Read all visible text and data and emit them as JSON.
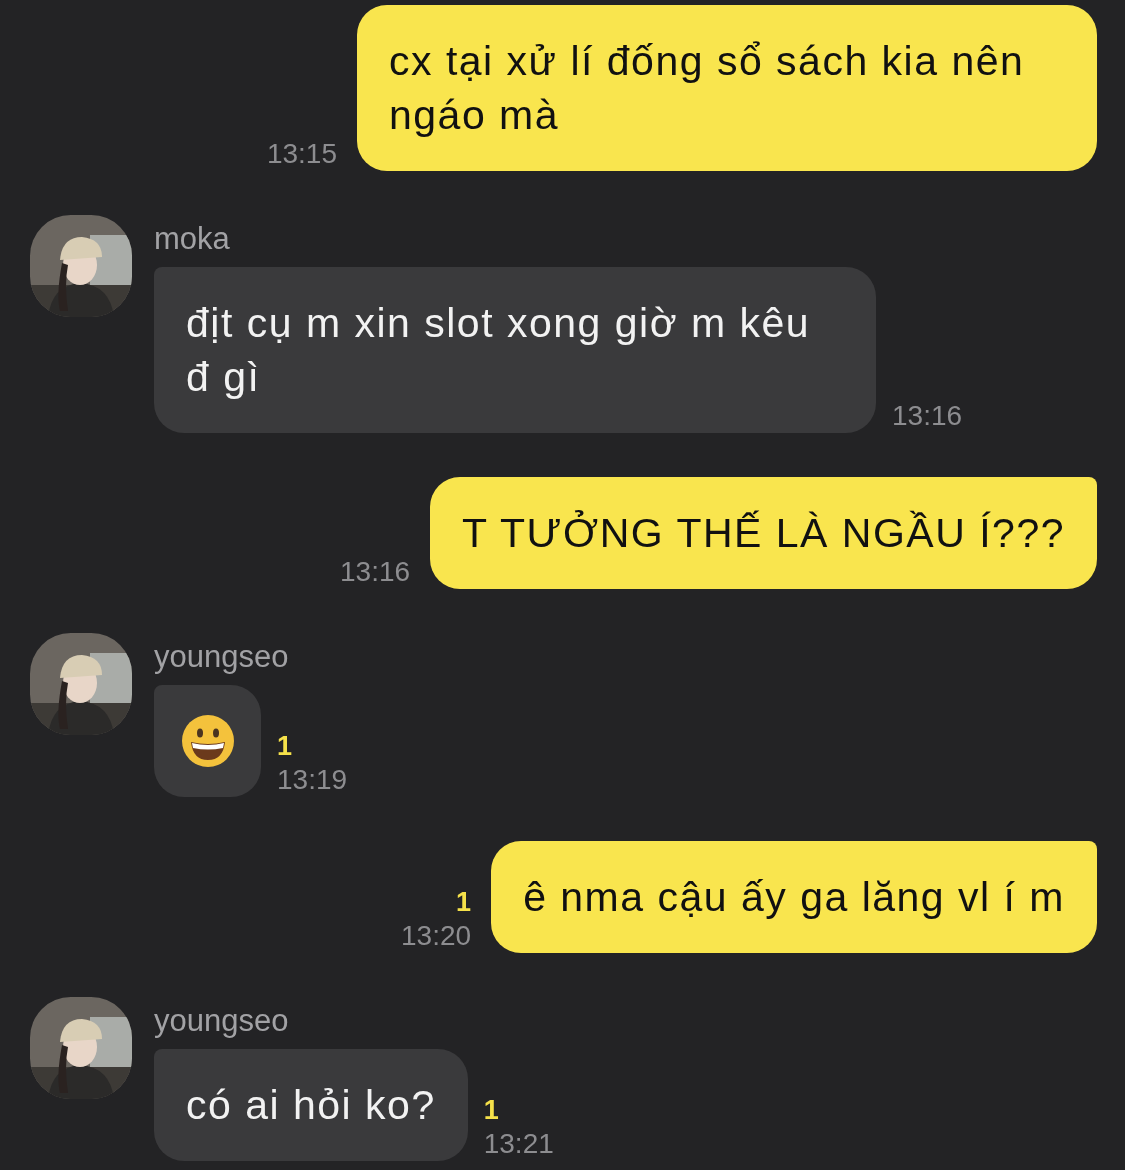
{
  "messages": [
    {
      "kind": "sent",
      "text": "cx tại xử lí đống sổ sách kia nên ngáo mà",
      "time": "13:15",
      "tail": false
    },
    {
      "kind": "received",
      "sender": "moka",
      "text": "địt cụ m xin slot xong giờ m kêu đ gì",
      "time": "13:16",
      "tail": true
    },
    {
      "kind": "sent",
      "text": "T TƯỞNG THẾ LÀ NGẦU Í???",
      "time": "13:16",
      "tail": true
    },
    {
      "kind": "received_emoji",
      "sender": "youngseo",
      "unread": "1",
      "time": "13:19",
      "tail": true
    },
    {
      "kind": "sent",
      "text": "ê nma cậu ấy ga lăng vl í m",
      "unread": "1",
      "time": "13:20",
      "tail": true
    },
    {
      "kind": "received",
      "sender": "youngseo",
      "text": "có ai hỏi ko?",
      "unread": "1",
      "time": "13:21",
      "tail": true
    }
  ]
}
